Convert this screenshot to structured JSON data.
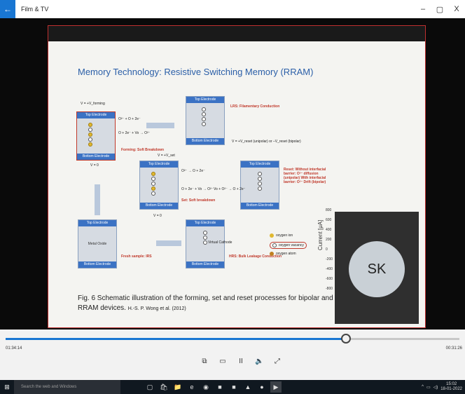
{
  "window": {
    "app_title": "Film & TV",
    "back_icon": "back-arrow-icon",
    "minimize": "–",
    "maximize": "▢",
    "close": "X"
  },
  "slide": {
    "title": "Memory Technology: Resistive Switching Memory (RRAM)",
    "caption_line1": "Fig. 6 Schematic illustration of the forming, set and reset processes for bipolar and unipo",
    "caption_line2": "RRAM devices.",
    "caption_ref": "H.-S. P. Wong et al. (2012)",
    "diagram": {
      "top_electrode": "Top Electrode",
      "bottom_electrode": "Bottom Electrode",
      "metal_oxide": "Metal Oxide",
      "v_forming": "V = +V_forming",
      "v_zero": "V = 0",
      "v_set": "V = +V_set",
      "v_reset": "V = +V_reset (unipolar) or –V_reset (bipolar)",
      "forming_label": "Forming: Soft Breakdown",
      "set_label": "Set: Soft breakdown",
      "lrs_label": "LRS: Filamentary Conduction",
      "hrs_label": "HRS: Bulk Leakage Conduction",
      "reset_label": "Reset: Without interfacial barrier: O²⁻ diffusion (unipolar) With interfacial barrier: O²⁻ Drift (bipolar)",
      "fresh_sample": "Fresh sample: IRS",
      "virtual_cathode": "Virtual Cathode",
      "eq1": "O²⁻ + O + 2e⁻",
      "eq2": "O + 2e⁻ + Vo → O²⁻",
      "eq3": "O²⁻ → O + 2e⁻",
      "eq4": "Vo + O²⁻ → O + 2e⁻",
      "legend": [
        {
          "label": "oxygen ion",
          "color": "#e0b830"
        },
        {
          "label": "oxygen vacancy",
          "color": "#ffffff"
        },
        {
          "label": "oxygen atom",
          "color": "#c08020"
        }
      ]
    },
    "graph": {
      "ylabel": "Current [μA]",
      "ticks": [
        "800",
        "600",
        "400",
        "200",
        "0",
        "-200",
        "-400",
        "-600",
        "-800"
      ]
    }
  },
  "participant": {
    "initials": "SK"
  },
  "player": {
    "current_time": "01:34:14",
    "remaining_time": "00:31:26",
    "progress_fraction": 0.75,
    "buttons": [
      {
        "name": "mini-view-icon",
        "glyph": "⧉"
      },
      {
        "name": "aspect-ratio-icon",
        "glyph": "▭"
      },
      {
        "name": "pause-icon",
        "glyph": "II"
      },
      {
        "name": "volume-icon",
        "glyph": "🔈"
      },
      {
        "name": "fullscreen-icon",
        "glyph": "⤢"
      }
    ]
  },
  "taskbar": {
    "search_placeholder": "Search the web and Windows",
    "time": "15:02",
    "date": "18-01-2022",
    "apps": [
      "task-view-icon",
      "store-icon",
      "file-explorer-icon",
      "edge-icon",
      "firefox-icon",
      "app-icon",
      "app-icon",
      "pdf-icon",
      "chrome-icon",
      "film-tv-icon"
    ]
  }
}
